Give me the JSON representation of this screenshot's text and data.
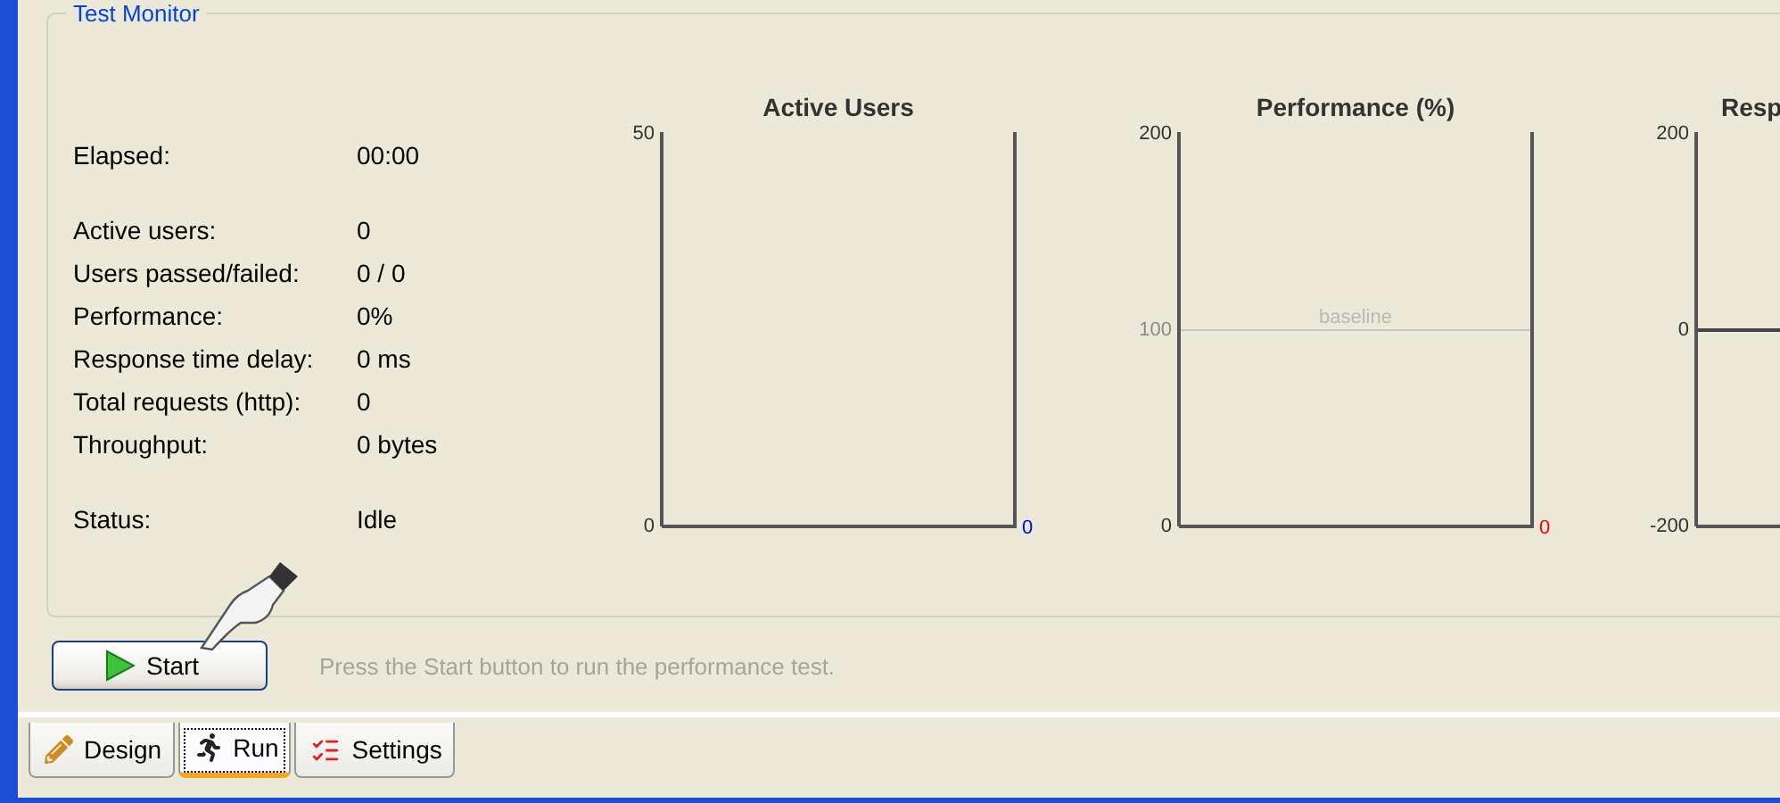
{
  "group": {
    "title": "Test Monitor"
  },
  "stat_groups": [
    [
      {
        "label": "Elapsed:",
        "value": "00:00"
      }
    ],
    [
      {
        "label": "Active users:",
        "value": "0"
      },
      {
        "label": "Users passed/failed:",
        "value": "0 / 0"
      },
      {
        "label": "Performance:",
        "value": "0%"
      },
      {
        "label": "Response time delay:",
        "value": "0 ms"
      },
      {
        "label": "Total requests (http):",
        "value": "0"
      },
      {
        "label": "Throughput:",
        "value": "0 bytes"
      }
    ],
    [
      {
        "label": "Status:",
        "value": "Idle"
      }
    ]
  ],
  "charts": [
    {
      "title": "Active Users",
      "truncated": false,
      "ticks": [
        {
          "label": "50",
          "muted": false
        },
        {
          "label": "0",
          "muted": false
        }
      ],
      "reading": {
        "text": "0",
        "color": "#0000ff"
      }
    },
    {
      "title": "Performance (%)",
      "truncated": false,
      "ticks": [
        {
          "label": "200",
          "muted": false
        },
        {
          "label": "100",
          "muted": true
        },
        {
          "label": "0",
          "muted": false
        }
      ],
      "reference_line": {
        "kind": "baseline",
        "label": "baseline"
      },
      "reading": {
        "text": "0",
        "color": "#ff0000"
      }
    },
    {
      "title": "Resp",
      "truncated": true,
      "ticks": [
        {
          "label": "200",
          "muted": false
        },
        {
          "label": "0",
          "muted": false
        },
        {
          "label": "-200",
          "muted": false
        }
      ],
      "reference_line": {
        "kind": "zero"
      }
    }
  ],
  "start_button": {
    "label": "Start"
  },
  "hint": "Press the Start button to run the performance test.",
  "tabs": [
    {
      "label": "Design",
      "kind": "design",
      "selected": false
    },
    {
      "label": "Run",
      "kind": "run",
      "selected": true
    },
    {
      "label": "Settings",
      "kind": "settings",
      "selected": false
    }
  ]
}
